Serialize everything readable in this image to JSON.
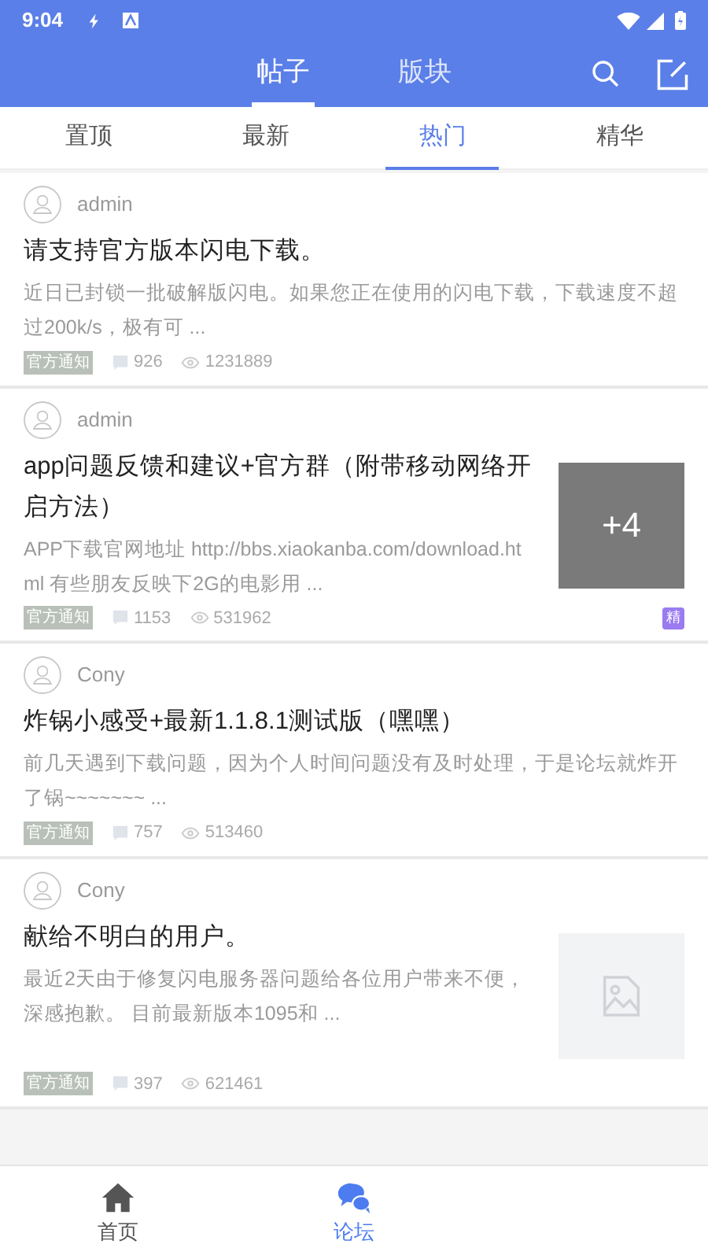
{
  "status_bar": {
    "time": "9:04"
  },
  "header": {
    "tabs": [
      {
        "label": "帖子",
        "selected": true
      },
      {
        "label": "版块",
        "selected": false
      }
    ]
  },
  "sub_tabs": [
    {
      "label": "置顶",
      "selected": false
    },
    {
      "label": "最新",
      "selected": false
    },
    {
      "label": "热门",
      "selected": true
    },
    {
      "label": "精华",
      "selected": false
    }
  ],
  "posts": [
    {
      "author": "admin",
      "title": "请支持官方版本闪电下载。",
      "excerpt": "近日已封锁一批破解版闪电。如果您正在使用的闪电下载，下载速度不超过200k/s，极有可 ...",
      "tag": "官方通知",
      "comments": "926",
      "views": "1231889"
    },
    {
      "author": "admin",
      "title": "app问题反馈和建议+官方群（附带移动网络开启方法）",
      "excerpt": "APP下载官网地址 http://bbs.xiaokanba.com/download.html 有些朋友反映下2G的电影用 ...",
      "tag": "官方通知",
      "comments": "1153",
      "views": "531962",
      "thumbnail": {
        "kind": "more",
        "count": "+4"
      },
      "badge": "精"
    },
    {
      "author": "Cony",
      "title": "炸锅小感受+最新1.1.8.1测试版（嘿嘿）",
      "excerpt": "前几天遇到下载问题，因为个人时间问题没有及时处理，于是论坛就炸开了锅~~~~~~~ ...",
      "tag": "官方通知",
      "comments": "757",
      "views": "513460"
    },
    {
      "author": "Cony",
      "title": "献给不明白的用户。",
      "excerpt": "最近2天由于修复闪电服务器问题给各位用户带来不便，深感抱歉。 目前最新版本1095和 ...",
      "tag": "官方通知",
      "comments": "397",
      "views": "621461",
      "thumbnail": {
        "kind": "empty"
      }
    }
  ],
  "bottom_nav": [
    {
      "label": "首页",
      "kind": "home",
      "selected": false
    },
    {
      "label": "论坛",
      "kind": "forum",
      "selected": true
    }
  ]
}
